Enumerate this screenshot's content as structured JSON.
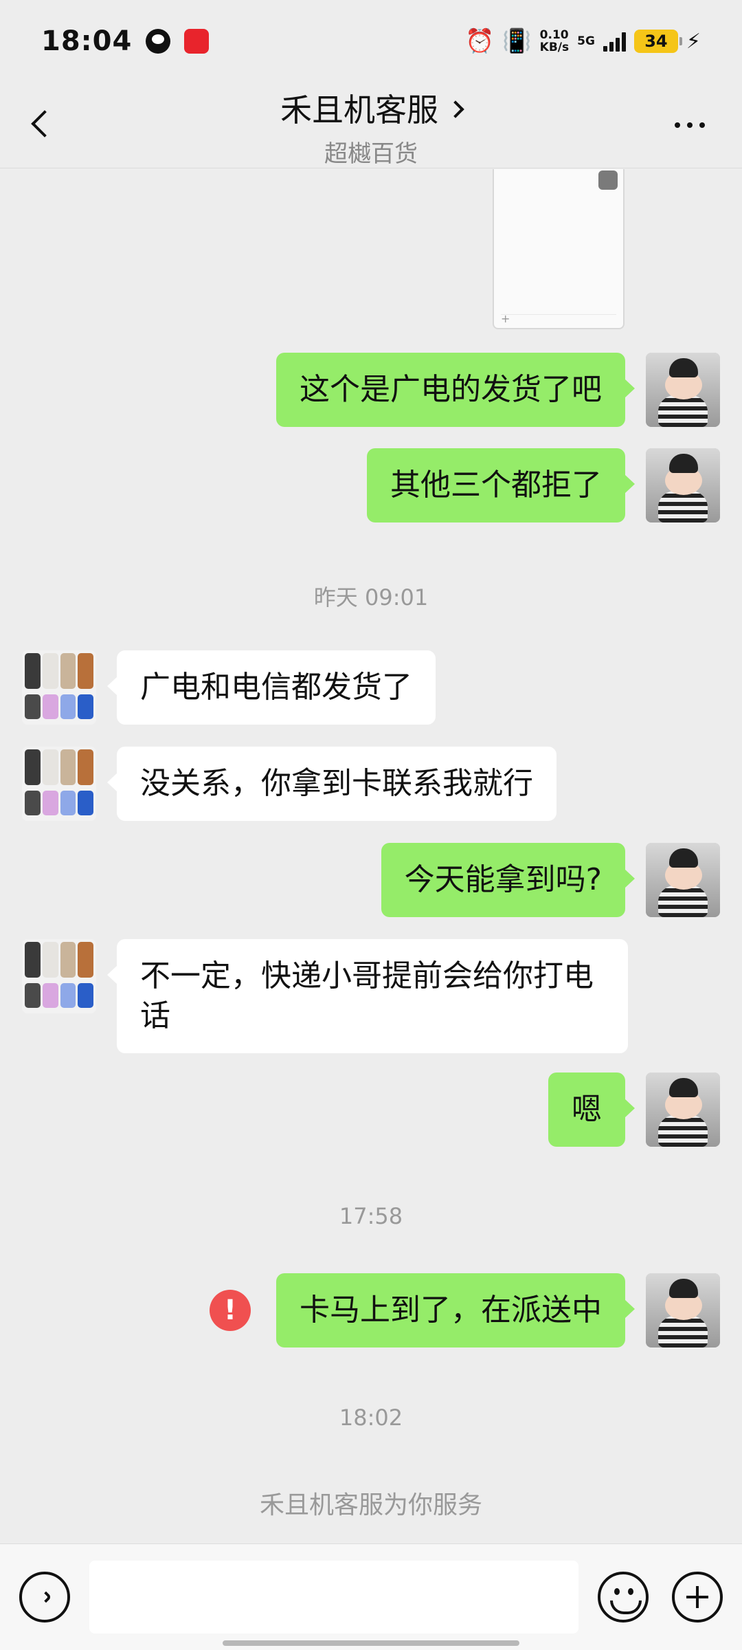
{
  "status_bar": {
    "time": "18:04",
    "net_speed_value": "0.10",
    "net_speed_unit": "KB/s",
    "network_type": "5G",
    "battery_level": "34",
    "icons": [
      "qq-icon",
      "app-red-icon",
      "alarm-icon",
      "vibrate-icon",
      "signal-icon",
      "battery-icon",
      "charging-icon"
    ]
  },
  "header": {
    "title": "禾且机客服",
    "subtitle": "超樾百货"
  },
  "messages": [
    {
      "from": "me",
      "text": "这个是广电的发货了吧"
    },
    {
      "from": "me",
      "text": "其他三个都拒了"
    },
    {
      "from": "them",
      "text": "广电和电信都发货了"
    },
    {
      "from": "them",
      "text": "没关系，你拿到卡联系我就行"
    },
    {
      "from": "me",
      "text": "今天能拿到吗?"
    },
    {
      "from": "them",
      "text": "不一定，快递小哥提前会给你打电话"
    },
    {
      "from": "me",
      "text": "嗯"
    },
    {
      "from": "me",
      "text": "卡马上到了，在派送中",
      "status": "failed",
      "status_symbol": "!"
    }
  ],
  "timestamps": [
    "昨天 09:01",
    "17:58",
    "18:02"
  ],
  "system_notice": "禾且机客服为你服务",
  "input": {
    "value": "",
    "placeholder": ""
  },
  "colors": {
    "my_bubble": "#95ec69",
    "their_bubble": "#ffffff",
    "background": "#ededed",
    "error": "#f05050",
    "battery": "#f5c518"
  }
}
